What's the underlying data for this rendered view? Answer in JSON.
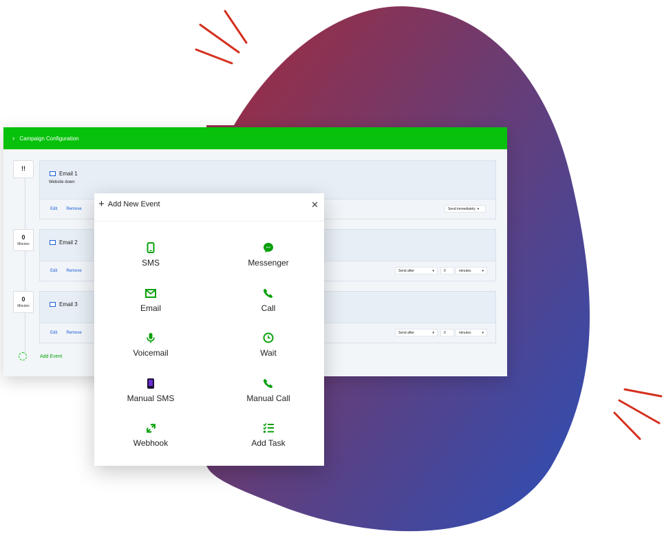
{
  "header": {
    "title": "Campaign Configuration"
  },
  "timeline": {
    "steps": [
      {
        "num": "!!",
        "unit": ""
      },
      {
        "num": "0",
        "unit": "Minutes"
      },
      {
        "num": "0",
        "unit": "Minutes"
      }
    ],
    "add_event_label": "Add Event"
  },
  "events": [
    {
      "title": "Email 1",
      "subtitle": "Website down",
      "edit": "Edit",
      "remove": "Remove",
      "send_mode": "Send  immediately"
    },
    {
      "title": "Email 2",
      "subtitle": "",
      "edit": "Edit",
      "remove": "Remove",
      "send_mode": "Send  after",
      "amount": "0",
      "unit": "minutes"
    },
    {
      "title": "Email 3",
      "subtitle": "",
      "edit": "Edit",
      "remove": "Remove",
      "send_mode": "Send  after",
      "amount": "0",
      "unit": "minutes"
    }
  ],
  "modal": {
    "title": "Add New Event",
    "options": [
      {
        "label": "SMS",
        "icon": "mobile-phone-icon"
      },
      {
        "label": "Messenger",
        "icon": "messenger-icon"
      },
      {
        "label": "Email",
        "icon": "envelope-icon"
      },
      {
        "label": "Call",
        "icon": "phone-icon"
      },
      {
        "label": "Voicemail",
        "icon": "microphone-icon"
      },
      {
        "label": "Wait",
        "icon": "clock-icon"
      },
      {
        "label": "Manual SMS",
        "icon": "mobile-phone-dark-icon"
      },
      {
        "label": "Manual Call",
        "icon": "phone-icon"
      },
      {
        "label": "Webhook",
        "icon": "webhook-icon"
      },
      {
        "label": "Add Task",
        "icon": "task-list-icon"
      }
    ]
  },
  "colors": {
    "header_green": "#07c10c",
    "icon_green": "#07a00a",
    "link_blue": "#1a5bd6",
    "blob_start": "#a52a3a",
    "blob_end": "#2b4fb8",
    "accent_red": "#d4301e"
  }
}
